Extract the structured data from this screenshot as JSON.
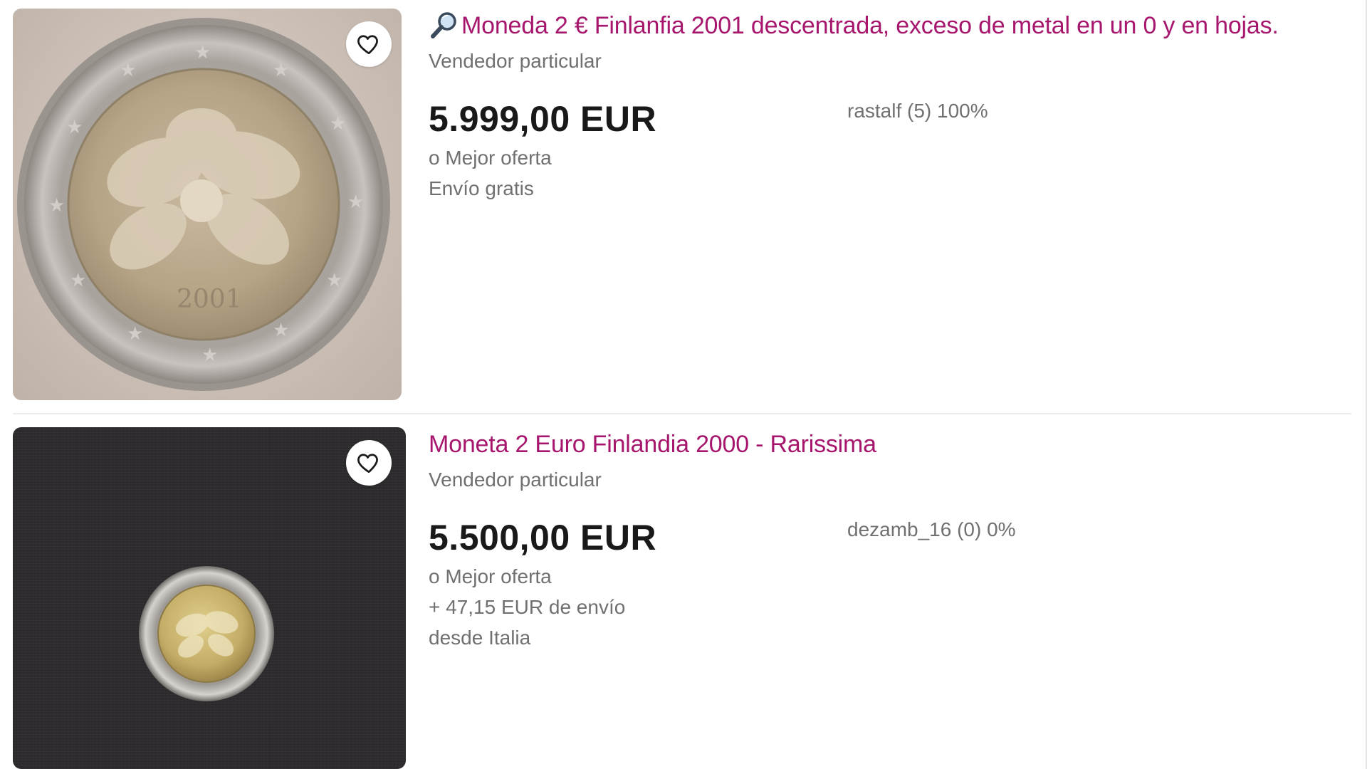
{
  "listings": [
    {
      "title_icon": "magnifier-icon",
      "title": "Moneda 2 € Finlanfia 2001 descentrada, exceso de metal en un 0 y en hojas.",
      "seller_type": "Vendedor particular",
      "price": "5.999,00 EUR",
      "seller": "rastalf (5) 100%",
      "offer": "o Mejor oferta",
      "shipping": "Envío gratis",
      "favorite_icon": "heart-outline-icon",
      "image_alt": "2 euro coin Finland 2001 close-up"
    },
    {
      "title": "Moneta 2 Euro Finlandia 2000 - Rarissima",
      "seller_type": "Vendedor particular",
      "price": "5.500,00 EUR",
      "seller": "dezamb_16 (0) 0%",
      "offer": "o Mejor oferta",
      "shipping": "+ 47,15 EUR de envío",
      "location": "desde Italia",
      "favorite_icon": "heart-outline-icon",
      "image_alt": "2 euro coin Finland 2000 on dark cloth"
    }
  ],
  "colors": {
    "title": "#a6166d",
    "secondary_text": "#707070",
    "price": "#191919"
  }
}
